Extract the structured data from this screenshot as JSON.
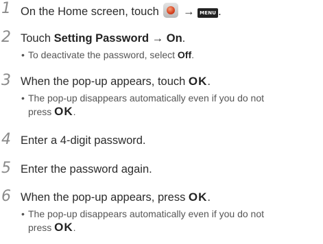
{
  "steps": [
    {
      "num": "1",
      "pre": "On the Home screen, touch",
      "arrow": "→",
      "menu_icon_label": "MENU",
      "post": "."
    },
    {
      "num": "2",
      "pre": "Touch ",
      "bold1": "Setting Password",
      "arrow": " → ",
      "bold2": "On",
      "post": ".",
      "sub": {
        "bullet": "•",
        "pre": "To deactivate the password, select ",
        "bold": "Off",
        "post": "."
      }
    },
    {
      "num": "3",
      "pre": "When the pop-up appears, touch ",
      "ok": "OK",
      "post": ".",
      "sub": {
        "bullet": "•",
        "line1": "The pop-up disappears automatically even if you do not",
        "pre2": "press ",
        "ok": "OK",
        "post": "."
      }
    },
    {
      "num": "4",
      "text": "Enter a 4-digit password."
    },
    {
      "num": "5",
      "text": "Enter the password again."
    },
    {
      "num": "6",
      "pre": "When the pop-up appears, press ",
      "ok": "OK",
      "post": ".",
      "sub": {
        "bullet": "•",
        "line1": "The pop-up disappears automatically even if you do not",
        "pre2": "press ",
        "ok": "OK",
        "post": "."
      }
    }
  ]
}
